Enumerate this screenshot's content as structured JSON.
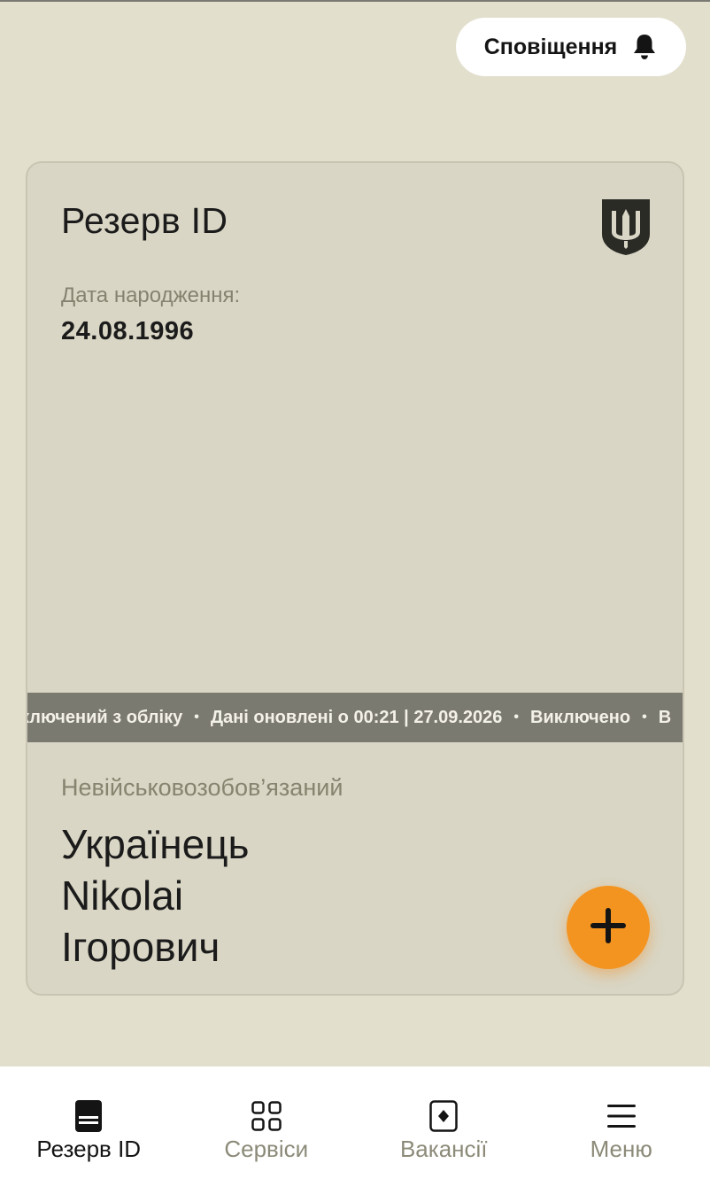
{
  "header": {
    "notifications_label": "Сповіщення",
    "notifications_icon": "bell-icon"
  },
  "card": {
    "title": "Резерв ID",
    "emblem_icon": "trident-shield-icon",
    "dob_label": "Дата народження:",
    "dob_value": "24.08.1996",
    "ticker": [
      "ключений з обліку",
      "Дані оновлені о 00:21 | 27.09.2026",
      "Виключено",
      "В"
    ],
    "status": "Невійськовозобов’язаний",
    "name": {
      "surname": "Українець",
      "given": "Nikolai",
      "patronymic": "Ігорович"
    },
    "fab_icon": "plus-icon"
  },
  "nav": {
    "items": [
      {
        "label": "Резерв ID",
        "icon": "document-icon",
        "active": true
      },
      {
        "label": "Сервіси",
        "icon": "grid-icon",
        "active": false
      },
      {
        "label": "Вакансії",
        "icon": "vacancy-icon",
        "active": false
      },
      {
        "label": "Меню",
        "icon": "menu-icon",
        "active": false
      }
    ]
  },
  "colors": {
    "background": "#e2dfcd",
    "card": "#d9d6c5",
    "ticker": "#7b7a71",
    "accent": "#f39320"
  }
}
